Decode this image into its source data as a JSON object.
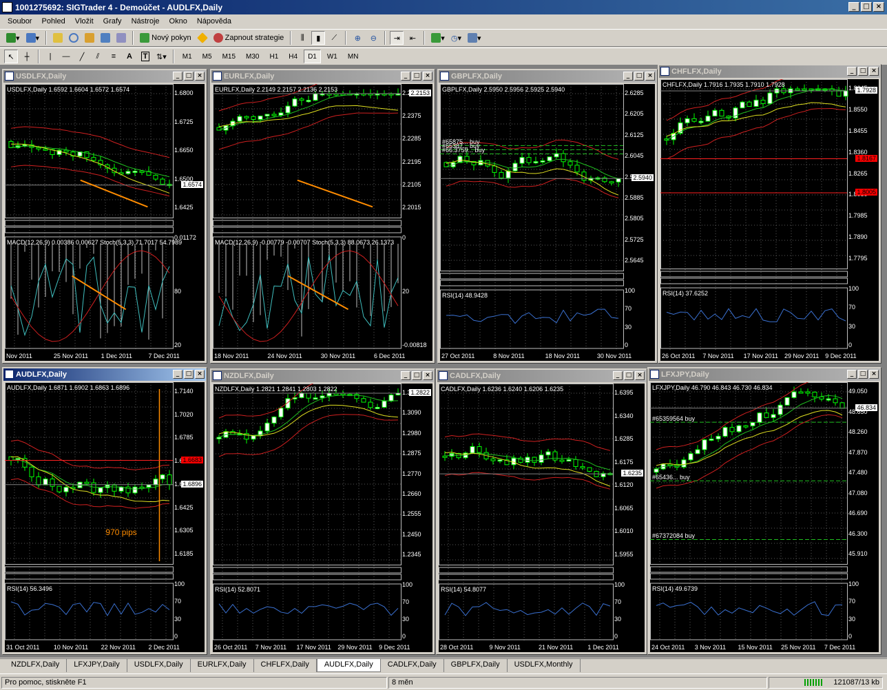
{
  "app": {
    "title": "1001275692: SIGTrader 4 - Demoúčet - AUDLFX,Daily"
  },
  "menu": [
    "Soubor",
    "Pohled",
    "Vložit",
    "Grafy",
    "Nástroje",
    "Okno",
    "Nápověda"
  ],
  "toolbar": {
    "new_order": "Nový pokyn",
    "strategies": "Zapnout strategie"
  },
  "timeframes": [
    "M1",
    "M5",
    "M15",
    "M30",
    "H1",
    "H4",
    "D1",
    "W1",
    "MN"
  ],
  "active_timeframe": "D1",
  "windows": [
    {
      "title": "USDLFX,Daily",
      "header": "USDLFX,Daily  1.6592 1.6604 1.6572 1.6574",
      "prices": [
        "1.6800",
        "1.6725",
        "1.6650",
        "1.6500",
        "1.6425"
      ],
      "price_tag": "1.6574",
      "ind1": "MACD(12,26,9) 0.00386 0.00627  Stoch(5,3,3) 71.7017 54.7989",
      "ind1_levels": [
        "0.01172",
        "80",
        "20"
      ],
      "dates": [
        "Nov 2011",
        "25 Nov 2011",
        "1 Dec 2011",
        "7 Dec 2011"
      ],
      "color": "#00c000"
    },
    {
      "title": "EURLFX,Daily",
      "header": "EURLFX,Daily  2.2149 2.2157 2.2136 2.2153",
      "prices": [
        "2.2465",
        "2.2375",
        "2.2285",
        "2.2195",
        "2.2105",
        "2.2015"
      ],
      "price_tag": "2.2153",
      "ind1": "MACD(12,26,9) -0.00779 -0.00707  Stoch(5,3,3) 88.0673 26.1373",
      "ind1_levels": [
        "0",
        "20",
        "-0.00818"
      ],
      "dates": [
        "18 Nov 2011",
        "24 Nov 2011",
        "30 Nov 2011",
        "6 Dec 2011"
      ]
    },
    {
      "title": "GBPLFX,Daily",
      "header": "GBPLFX,Daily  2.5950 2.5956 2.5925 2.5940",
      "prices": [
        "2.6285",
        "2.6205",
        "2.6125",
        "2.6045",
        "2.5965",
        "2.5885",
        "2.5805",
        "2.5725",
        "2.5645"
      ],
      "price_tag": "2.5940",
      "ind1": "RSI(14) 48.9428",
      "ind1_levels": [
        "100",
        "70",
        "30",
        "0"
      ],
      "dates": [
        "27 Oct 2011",
        "8 Nov 2011",
        "18 Nov 2011",
        "30 Nov 2011"
      ],
      "orders": [
        "#65875... buy",
        "#65387... buy",
        "#66.3759... buy"
      ]
    },
    {
      "title": "CHFLFX,Daily",
      "header": "CHFLFX,Daily  1.7916 1.7935 1.7910 1.7928",
      "prices": [
        "1.8645",
        "1.8550",
        "1.8455",
        "1.8360",
        "1.8265",
        "1.8080",
        "1.7985",
        "1.7890",
        "1.7795"
      ],
      "price_tag": "1.7928",
      "red_tags": [
        "1.8167",
        "1.8005"
      ],
      "ind1": "RSI(14) 37.6252",
      "ind1_levels": [
        "100",
        "70",
        "30",
        "0"
      ],
      "dates": [
        "26 Oct 2011",
        "7 Nov 2011",
        "17 Nov 2011",
        "29 Nov 2011",
        "9 Dec 2011"
      ]
    },
    {
      "title": "AUDLFX,Daily",
      "header": "AUDLFX,Daily  1.6871 1.6902 1.6863 1.6896",
      "prices": [
        "1.7140",
        "1.7020",
        "1.6785",
        "1.6665",
        "1.6545",
        "1.6425",
        "1.6305",
        "1.6185"
      ],
      "price_tag": "1.6896",
      "red_tags": [
        "1.6683"
      ],
      "annotation": "970 pips",
      "ind1": "RSI(14) 56.3496",
      "ind1_levels": [
        "100",
        "70",
        "30",
        "0"
      ],
      "dates": [
        "31 Oct 2011",
        "10 Nov 2011",
        "22 Nov 2011",
        "2 Dec 2011"
      ]
    },
    {
      "title": "NZDLFX,Daily",
      "header": "NZDLFX,Daily  1.2821 1.2841 1.2803 1.2822",
      "prices": [
        "1.3195",
        "1.3090",
        "1.2980",
        "1.2875",
        "1.2770",
        "1.2660",
        "1.2555",
        "1.2450",
        "1.2345"
      ],
      "price_tag": "1.2822",
      "ind1": "RSI(14) 52.8071",
      "ind1_levels": [
        "100",
        "70",
        "30",
        "0"
      ],
      "dates": [
        "26 Oct 2011",
        "7 Nov 2011",
        "17 Nov 2011",
        "29 Nov 2011",
        "9 Dec 2011"
      ]
    },
    {
      "title": "CADLFX,Daily",
      "header": "CADLFX,Daily  1.6236 1.6240 1.6206 1.6235",
      "prices": [
        "1.6395",
        "1.6340",
        "1.6285",
        "1.6175",
        "1.6120",
        "1.6065",
        "1.6010",
        "1.5955"
      ],
      "price_tag": "1.6235",
      "ind1": "RSI(14) 54.8077",
      "ind1_levels": [
        "100",
        "70",
        "30",
        "0"
      ],
      "dates": [
        "28 Oct 2011",
        "9 Nov 2011",
        "21 Nov 2011",
        "1 Dec 2011"
      ]
    },
    {
      "title": "LFXJPY,Daily",
      "header": "LFXJPY,Daily  46.790 46.843 46.730 46.834",
      "prices": [
        "49.050",
        "48.650",
        "48.260",
        "47.870",
        "47.480",
        "47.080",
        "46.690",
        "46.300",
        "45.910"
      ],
      "price_tag": "46.834",
      "ind1": "RSI(14) 49.6739",
      "ind1_levels": [
        "100",
        "70",
        "30",
        "0"
      ],
      "dates": [
        "24 Oct 2011",
        "3 Nov 2011",
        "15 Nov 2011",
        "25 Nov 2011",
        "7 Dec 2011"
      ],
      "orders": [
        "#65359564 buy",
        "#65436... buy",
        "#67372084 buy"
      ]
    }
  ],
  "tabs": [
    "NZDLFX,Daily",
    "LFXJPY,Daily",
    "USDLFX,Daily",
    "EURLFX,Daily",
    "CHFLFX,Daily",
    "AUDLFX,Daily",
    "CADLFX,Daily",
    "GBPLFX,Daily",
    "USDLFX,Monthly"
  ],
  "active_tab": "AUDLFX,Daily",
  "status": {
    "help": "Pro pomoc, stiskněte F1",
    "profile": "8 měn",
    "traffic": "121087/13 kb"
  }
}
